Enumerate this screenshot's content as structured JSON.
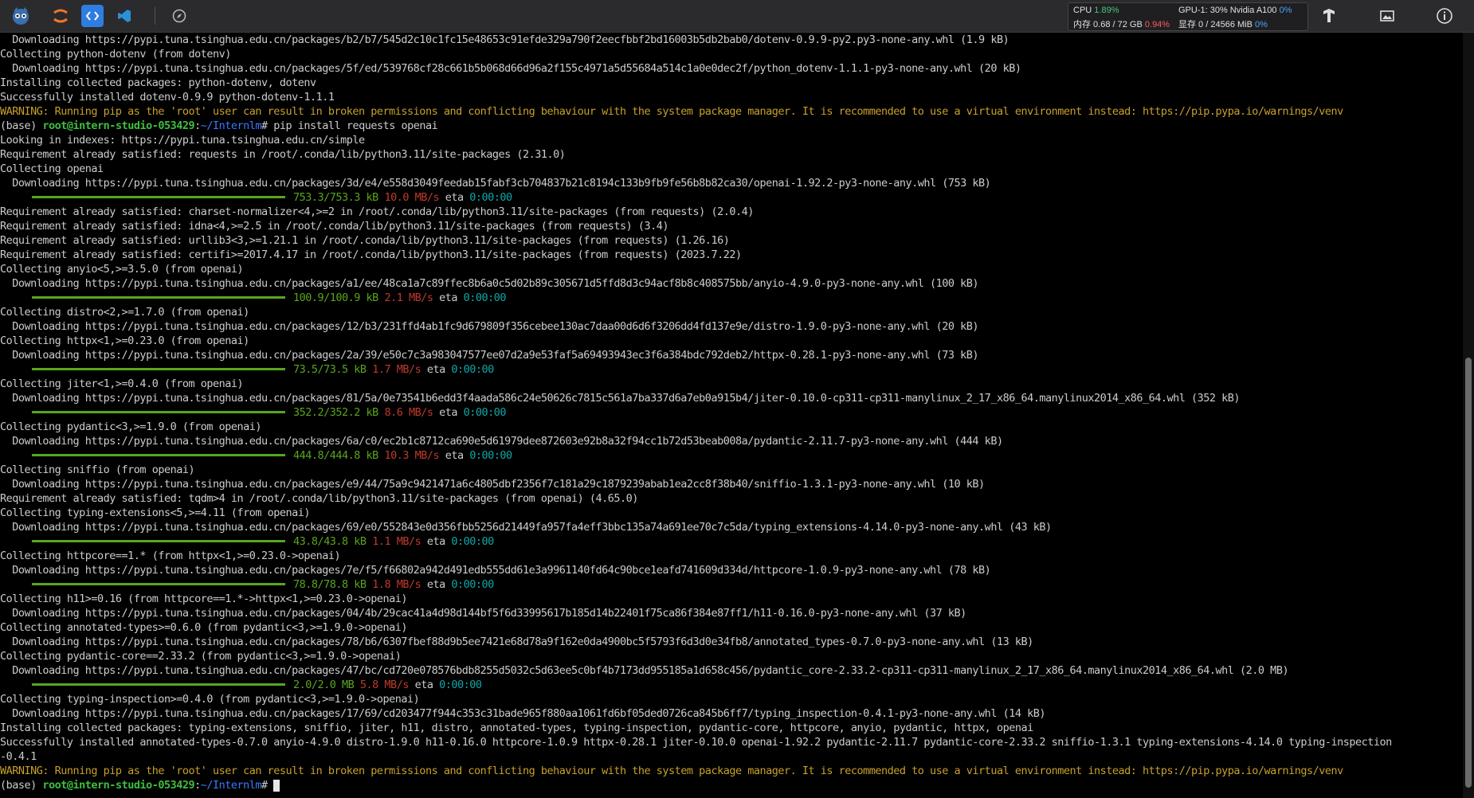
{
  "topbar": {
    "icons": [
      "mascot-icon",
      "jupyter-icon",
      "code-icon",
      "vscode-icon",
      "compass-icon"
    ],
    "cpu_label": "CPU",
    "cpu_value": "1.89%",
    "mem_label": "内存 0.68 / 72 GB",
    "mem_value": "0.94%",
    "gpu_label": "GPU-1: 30% Nvidia A100",
    "gpu_value": "0%",
    "vram_label": "显存 0 / 24566 MiB",
    "vram_value": "0%"
  },
  "terminal": {
    "lines": [
      {
        "t": "  Downloading https://pypi.tuna.tsinghua.edu.cn/packages/b2/b7/545d2c10c1fc15e48653c91efde329a790f2eecfbbf2bd16003b5db2bab0/dotenv-0.9.9-py2.py3-none-any.whl (1.9 kB)"
      },
      {
        "t": "Collecting python-dotenv (from dotenv)"
      },
      {
        "t": "  Downloading https://pypi.tuna.tsinghua.edu.cn/packages/5f/ed/539768cf28c661b5b068d66d96a2f155c4971a5d55684a514c1a0e0dec2f/python_dotenv-1.1.1-py3-none-any.whl (20 kB)"
      },
      {
        "t": "Installing collected packages: python-dotenv, dotenv"
      },
      {
        "t": "Successfully installed dotenv-0.9.9 python-dotenv-1.1.1"
      },
      {
        "t": "WARNING: Running pip as the 'root' user can result in broken permissions and conflicting behaviour with the system package manager. It is recommended to use a virtual environment instead: https://pip.pypa.io/warnings/venv",
        "k": "warn"
      },
      {
        "k": "prompt",
        "env": "(base) ",
        "user": "root@intern-studio-053429",
        "sep": ":",
        "path": "~/Internlm",
        "cmd": "# pip install requests openai"
      },
      {
        "t": "Looking in indexes: https://pypi.tuna.tsinghua.edu.cn/simple"
      },
      {
        "t": "Requirement already satisfied: requests in /root/.conda/lib/python3.11/site-packages (2.31.0)"
      },
      {
        "t": "Collecting openai"
      },
      {
        "t": "  Downloading https://pypi.tuna.tsinghua.edu.cn/packages/3d/e4/e558d3049feedab15fabf3cb704837b21c8194c133b9fb9fe56b8b82ca30/openai-1.92.2-py3-none-any.whl (753 kB)"
      },
      {
        "k": "prog",
        "size": "753.3/753.3 kB",
        "speed": "10.0 MB/s",
        "eta": "eta",
        "time": "0:00:00"
      },
      {
        "t": "Requirement already satisfied: charset-normalizer<4,>=2 in /root/.conda/lib/python3.11/site-packages (from requests) (2.0.4)"
      },
      {
        "t": "Requirement already satisfied: idna<4,>=2.5 in /root/.conda/lib/python3.11/site-packages (from requests) (3.4)"
      },
      {
        "t": "Requirement already satisfied: urllib3<3,>=1.21.1 in /root/.conda/lib/python3.11/site-packages (from requests) (1.26.16)"
      },
      {
        "t": "Requirement already satisfied: certifi>=2017.4.17 in /root/.conda/lib/python3.11/site-packages (from requests) (2023.7.22)"
      },
      {
        "t": "Collecting anyio<5,>=3.5.0 (from openai)"
      },
      {
        "t": "  Downloading https://pypi.tuna.tsinghua.edu.cn/packages/a1/ee/48ca1a7c89ffec8b6a0c5d02b89c305671d5ffd8d3c94acf8b8c408575bb/anyio-4.9.0-py3-none-any.whl (100 kB)"
      },
      {
        "k": "prog",
        "size": "100.9/100.9 kB",
        "speed": "2.1 MB/s",
        "eta": "eta",
        "time": "0:00:00"
      },
      {
        "t": "Collecting distro<2,>=1.7.0 (from openai)"
      },
      {
        "t": "  Downloading https://pypi.tuna.tsinghua.edu.cn/packages/12/b3/231ffd4ab1fc9d679809f356cebee130ac7daa00d6d6f3206dd4fd137e9e/distro-1.9.0-py3-none-any.whl (20 kB)"
      },
      {
        "t": "Collecting httpx<1,>=0.23.0 (from openai)"
      },
      {
        "t": "  Downloading https://pypi.tuna.tsinghua.edu.cn/packages/2a/39/e50c7c3a983047577ee07d2a9e53faf5a69493943ec3f6a384bdc792deb2/httpx-0.28.1-py3-none-any.whl (73 kB)"
      },
      {
        "k": "prog",
        "size": "73.5/73.5 kB",
        "speed": "1.7 MB/s",
        "eta": "eta",
        "time": "0:00:00"
      },
      {
        "t": "Collecting jiter<1,>=0.4.0 (from openai)"
      },
      {
        "t": "  Downloading https://pypi.tuna.tsinghua.edu.cn/packages/81/5a/0e73541b6edd3f4aada586c24e50626c7815c561a7ba337d6a7eb0a915b4/jiter-0.10.0-cp311-cp311-manylinux_2_17_x86_64.manylinux2014_x86_64.whl (352 kB)"
      },
      {
        "k": "prog",
        "size": "352.2/352.2 kB",
        "speed": "8.6 MB/s",
        "eta": "eta",
        "time": "0:00:00"
      },
      {
        "t": "Collecting pydantic<3,>=1.9.0 (from openai)"
      },
      {
        "t": "  Downloading https://pypi.tuna.tsinghua.edu.cn/packages/6a/c0/ec2b1c8712ca690e5d61979dee872603e92b8a32f94cc1b72d53beab008a/pydantic-2.11.7-py3-none-any.whl (444 kB)"
      },
      {
        "k": "prog",
        "size": "444.8/444.8 kB",
        "speed": "10.3 MB/s",
        "eta": "eta",
        "time": "0:00:00"
      },
      {
        "t": "Collecting sniffio (from openai)"
      },
      {
        "t": "  Downloading https://pypi.tuna.tsinghua.edu.cn/packages/e9/44/75a9c9421471a6c4805dbf2356f7c181a29c1879239abab1ea2cc8f38b40/sniffio-1.3.1-py3-none-any.whl (10 kB)"
      },
      {
        "t": "Requirement already satisfied: tqdm>4 in /root/.conda/lib/python3.11/site-packages (from openai) (4.65.0)"
      },
      {
        "t": "Collecting typing-extensions<5,>=4.11 (from openai)"
      },
      {
        "t": "  Downloading https://pypi.tuna.tsinghua.edu.cn/packages/69/e0/552843e0d356fbb5256d21449fa957fa4eff3bbc135a74a691ee70c7c5da/typing_extensions-4.14.0-py3-none-any.whl (43 kB)"
      },
      {
        "k": "prog",
        "size": "43.8/43.8 kB",
        "speed": "1.1 MB/s",
        "eta": "eta",
        "time": "0:00:00"
      },
      {
        "t": "Collecting httpcore==1.* (from httpx<1,>=0.23.0->openai)"
      },
      {
        "t": "  Downloading https://pypi.tuna.tsinghua.edu.cn/packages/7e/f5/f66802a942d491edb555dd61e3a9961140fd64c90bce1eafd741609d334d/httpcore-1.0.9-py3-none-any.whl (78 kB)"
      },
      {
        "k": "prog",
        "size": "78.8/78.8 kB",
        "speed": "1.8 MB/s",
        "eta": "eta",
        "time": "0:00:00"
      },
      {
        "t": "Collecting h11>=0.16 (from httpcore==1.*->httpx<1,>=0.23.0->openai)"
      },
      {
        "t": "  Downloading https://pypi.tuna.tsinghua.edu.cn/packages/04/4b/29cac41a4d98d144bf5f6d33995617b185d14b22401f75ca86f384e87ff1/h11-0.16.0-py3-none-any.whl (37 kB)"
      },
      {
        "t": "Collecting annotated-types>=0.6.0 (from pydantic<3,>=1.9.0->openai)"
      },
      {
        "t": "  Downloading https://pypi.tuna.tsinghua.edu.cn/packages/78/b6/6307fbef88d9b5ee7421e68d78a9f162e0da4900bc5f5793f6d3d0e34fb8/annotated_types-0.7.0-py3-none-any.whl (13 kB)"
      },
      {
        "t": "Collecting pydantic-core==2.33.2 (from pydantic<3,>=1.9.0->openai)"
      },
      {
        "t": "  Downloading https://pypi.tuna.tsinghua.edu.cn/packages/47/bc/cd720e078576bdb8255d5032c5d63ee5c0bf4b7173dd955185a1d658c456/pydantic_core-2.33.2-cp311-cp311-manylinux_2_17_x86_64.manylinux2014_x86_64.whl (2.0 MB)"
      },
      {
        "k": "prog",
        "size": "2.0/2.0 MB",
        "speed": "5.8 MB/s",
        "eta": "eta",
        "time": "0:00:00"
      },
      {
        "t": "Collecting typing-inspection>=0.4.0 (from pydantic<3,>=1.9.0->openai)"
      },
      {
        "t": "  Downloading https://pypi.tuna.tsinghua.edu.cn/packages/17/69/cd203477f944c353c31bade965f880aa1061fd6bf05ded0726ca845b6ff7/typing_inspection-0.4.1-py3-none-any.whl (14 kB)"
      },
      {
        "t": "Installing collected packages: typing-extensions, sniffio, jiter, h11, distro, annotated-types, typing-inspection, pydantic-core, httpcore, anyio, pydantic, httpx, openai"
      },
      {
        "t": "Successfully installed annotated-types-0.7.0 anyio-4.9.0 distro-1.9.0 h11-0.16.0 httpcore-1.0.9 httpx-0.28.1 jiter-0.10.0 openai-1.92.2 pydantic-2.11.7 pydantic-core-2.33.2 sniffio-1.3.1 typing-extensions-4.14.0 typing-inspection"
      },
      {
        "t": "-0.4.1"
      },
      {
        "t": "WARNING: Running pip as the 'root' user can result in broken permissions and conflicting behaviour with the system package manager. It is recommended to use a virtual environment instead: https://pip.pypa.io/warnings/venv",
        "k": "warn"
      },
      {
        "k": "prompt",
        "env": "(base) ",
        "user": "root@intern-studio-053429",
        "sep": ":",
        "path": "~/Internlm",
        "cmd": "# ",
        "cursor": true
      }
    ]
  }
}
